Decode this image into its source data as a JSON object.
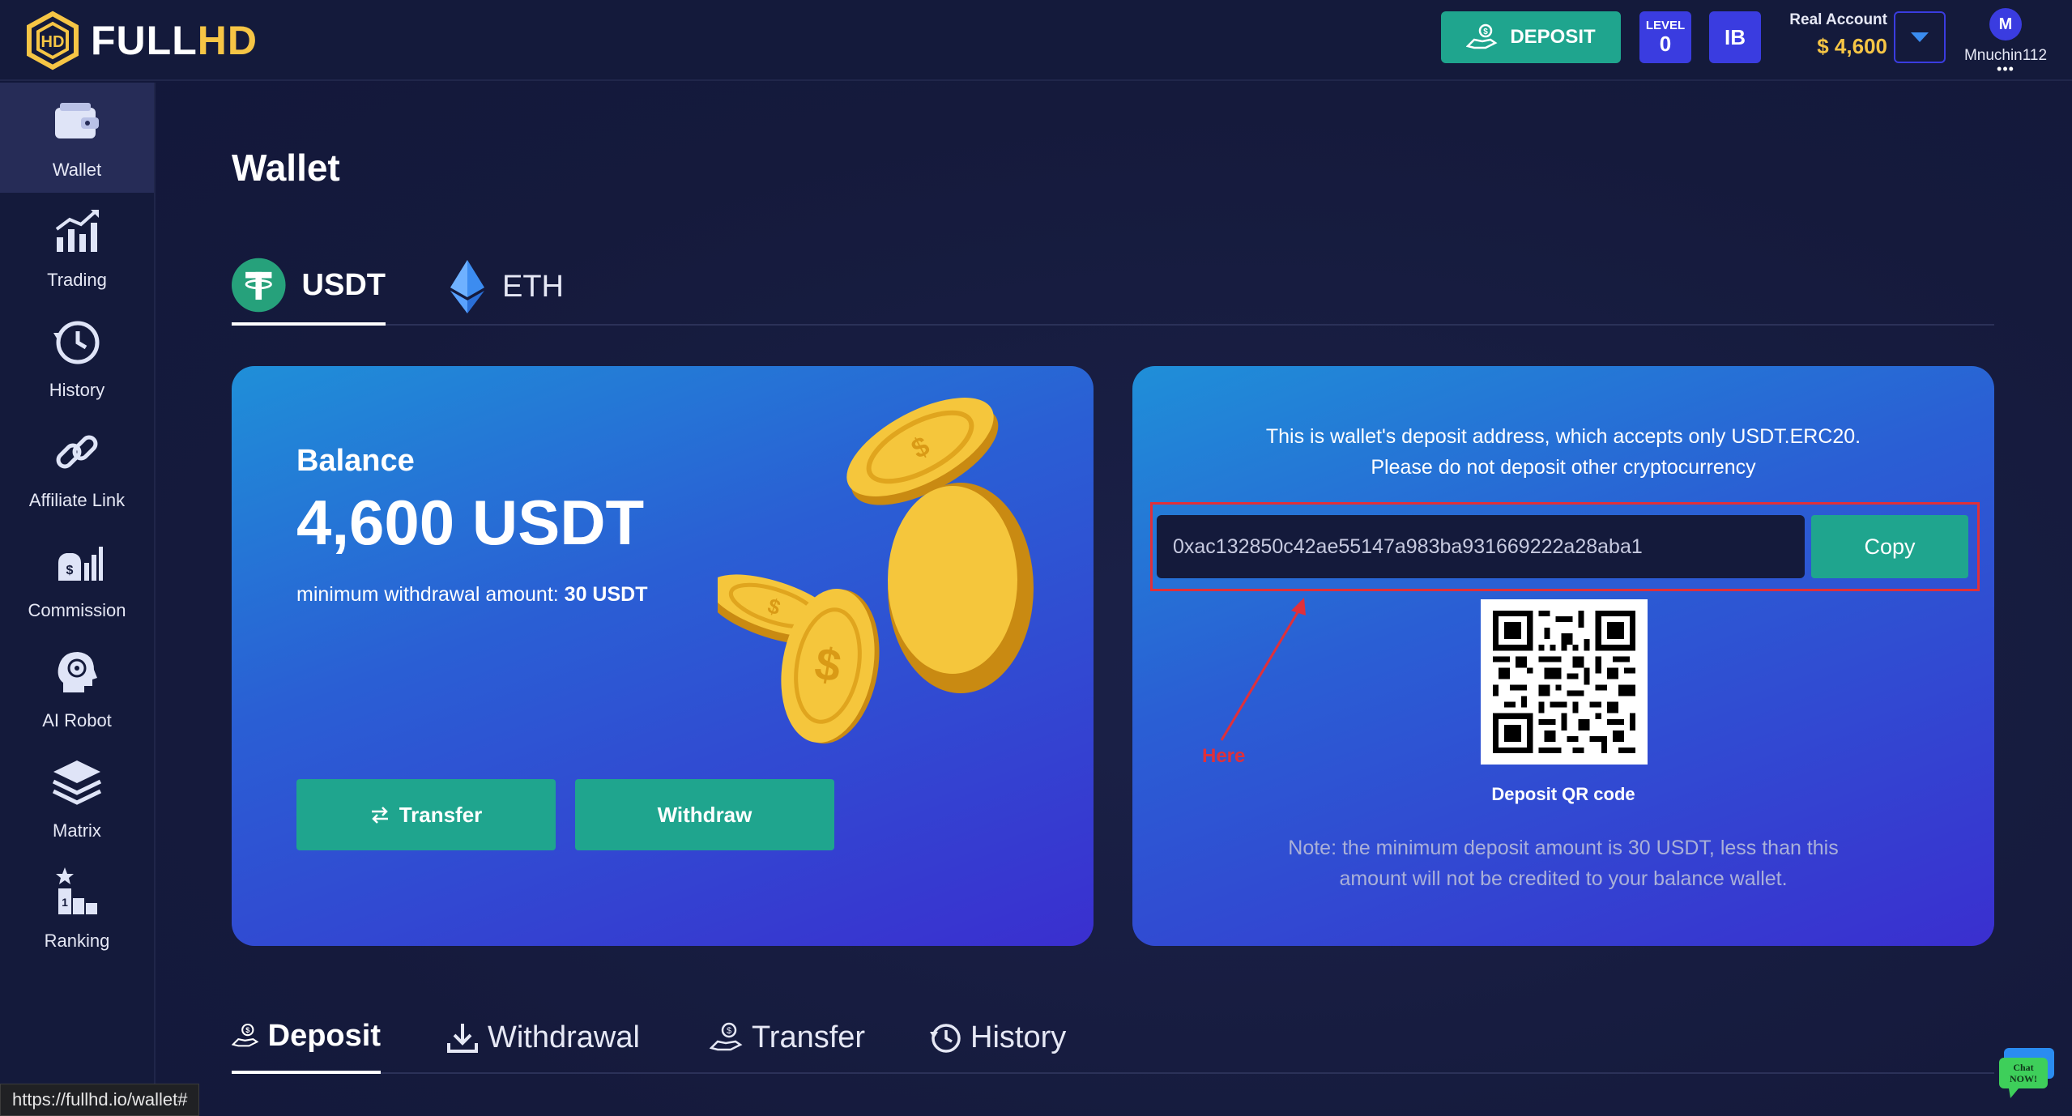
{
  "header": {
    "logo_text_full": "FULL",
    "logo_text_hd": "HD",
    "deposit_label": "DEPOSIT",
    "level_label": "LEVEL",
    "level_value": "0",
    "ib_label": "IB",
    "account_label": "Real Account",
    "account_amount": "$ 4,600",
    "user_initial": "M",
    "user_name": "Mnuchin112",
    "user_more": "•••"
  },
  "sidebar": {
    "items": [
      {
        "label": "Wallet",
        "icon": "wallet-icon",
        "active": true
      },
      {
        "label": "Trading",
        "icon": "trading-chart-icon"
      },
      {
        "label": "History",
        "icon": "history-icon"
      },
      {
        "label": "Affiliate Link",
        "icon": "link-icon"
      },
      {
        "label": "Commission",
        "icon": "commission-icon"
      },
      {
        "label": "AI Robot",
        "icon": "ai-robot-icon"
      },
      {
        "label": "Matrix",
        "icon": "matrix-layers-icon"
      },
      {
        "label": "Ranking",
        "icon": "ranking-icon"
      }
    ]
  },
  "main": {
    "title": "Wallet",
    "coin_tabs": [
      {
        "label": "USDT",
        "icon": "tether-icon",
        "active": true
      },
      {
        "label": "ETH",
        "icon": "ethereum-icon"
      }
    ],
    "balance": {
      "label": "Balance",
      "value": "4,600 USDT",
      "min_label": "minimum withdrawal amount:",
      "min_value": "30 USDT",
      "transfer_label": "Transfer",
      "withdraw_label": "Withdraw"
    },
    "deposit_address": {
      "info_line1": "This is wallet's deposit address, which accepts only USDT.ERC20.",
      "info_line2": "Please do not deposit other cryptocurrency",
      "address": "0xac132850c42ae55147a983ba931669222a28aba1",
      "copy_label": "Copy",
      "qr_label": "Deposit QR code",
      "note_line1": "Note: the minimum deposit amount is 30 USDT, less than this",
      "note_line2": "amount will not be credited to your balance wallet.",
      "annotation": "Here"
    },
    "bottom_tabs": [
      {
        "label": "Deposit",
        "icon": "deposit-hand-icon",
        "active": true
      },
      {
        "label": "Withdrawal",
        "icon": "download-icon"
      },
      {
        "label": "Transfer",
        "icon": "transfer-hand-icon"
      },
      {
        "label": "History",
        "icon": "history-icon"
      }
    ]
  },
  "status_bar": {
    "url": "https://fullhd.io/wallet#"
  },
  "chat_widget": {
    "line1": "Chat",
    "line2": "NOW!"
  },
  "colors": {
    "background": "#141a3b",
    "accent_teal": "#1fa58e",
    "accent_blue": "#3a3ce0",
    "gold": "#f6c545",
    "annotation_red": "#e0303a"
  }
}
